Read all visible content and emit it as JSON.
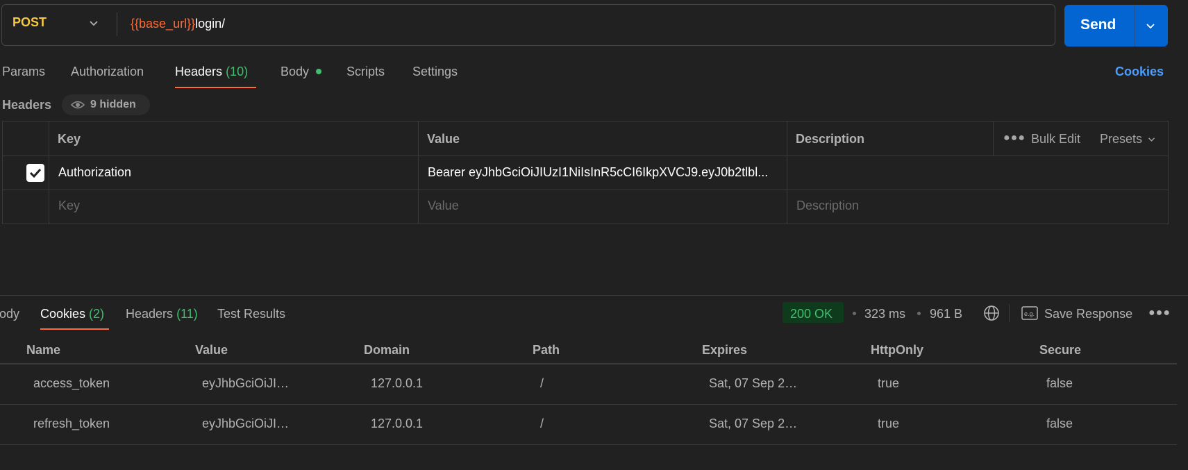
{
  "request": {
    "method": "POST",
    "url_variable": "{{base_url}}",
    "url_path": "login/",
    "send_label": "Send"
  },
  "request_tabs": [
    {
      "label": "Params"
    },
    {
      "label": "Authorization"
    },
    {
      "label": "Headers",
      "count": "(10)"
    },
    {
      "label": "Body"
    },
    {
      "label": "Scripts"
    },
    {
      "label": "Settings"
    }
  ],
  "cookies_link": "Cookies",
  "headers_section": {
    "title": "Headers",
    "hidden_label": "9 hidden"
  },
  "headers_table": {
    "columns": [
      "Key",
      "Value",
      "Description"
    ],
    "bulk_edit_label": "Bulk Edit",
    "presets_label": "Presets",
    "rows": [
      {
        "key": "Authorization",
        "value": "Bearer eyJhbGciOiJIUzI1NiIsInR5cCI6IkpXVCJ9.eyJ0b2tlbl...",
        "description": ""
      }
    ],
    "placeholders": {
      "key": "Key",
      "value": "Value",
      "description": "Description"
    }
  },
  "response": {
    "tabs": [
      {
        "label": "Body"
      },
      {
        "label": "Cookies",
        "count": "(2)"
      },
      {
        "label": "Headers",
        "count": "(11)"
      },
      {
        "label": "Test Results"
      }
    ],
    "status": "200 OK",
    "time": "323 ms",
    "size": "961 B",
    "save_label": "Save Response",
    "cookies_columns": [
      "Name",
      "Value",
      "Domain",
      "Path",
      "Expires",
      "HttpOnly",
      "Secure"
    ],
    "cookies": [
      {
        "name": "access_token",
        "value": "eyJhbGciOiJI…",
        "domain": "127.0.0.1",
        "path": "/",
        "expires": "Sat, 07 Sep 2…",
        "httponly": "true",
        "secure": "false"
      },
      {
        "name": "refresh_token",
        "value": "eyJhbGciOiJI…",
        "domain": "127.0.0.1",
        "path": "/",
        "expires": "Sat, 07 Sep 2…",
        "httponly": "true",
        "secure": "false"
      }
    ]
  },
  "colors": {
    "accent": "#ff6c37",
    "send": "#0265d2",
    "method": "#f5c842",
    "success": "#3fbf6f",
    "link": "#4c9dff"
  }
}
